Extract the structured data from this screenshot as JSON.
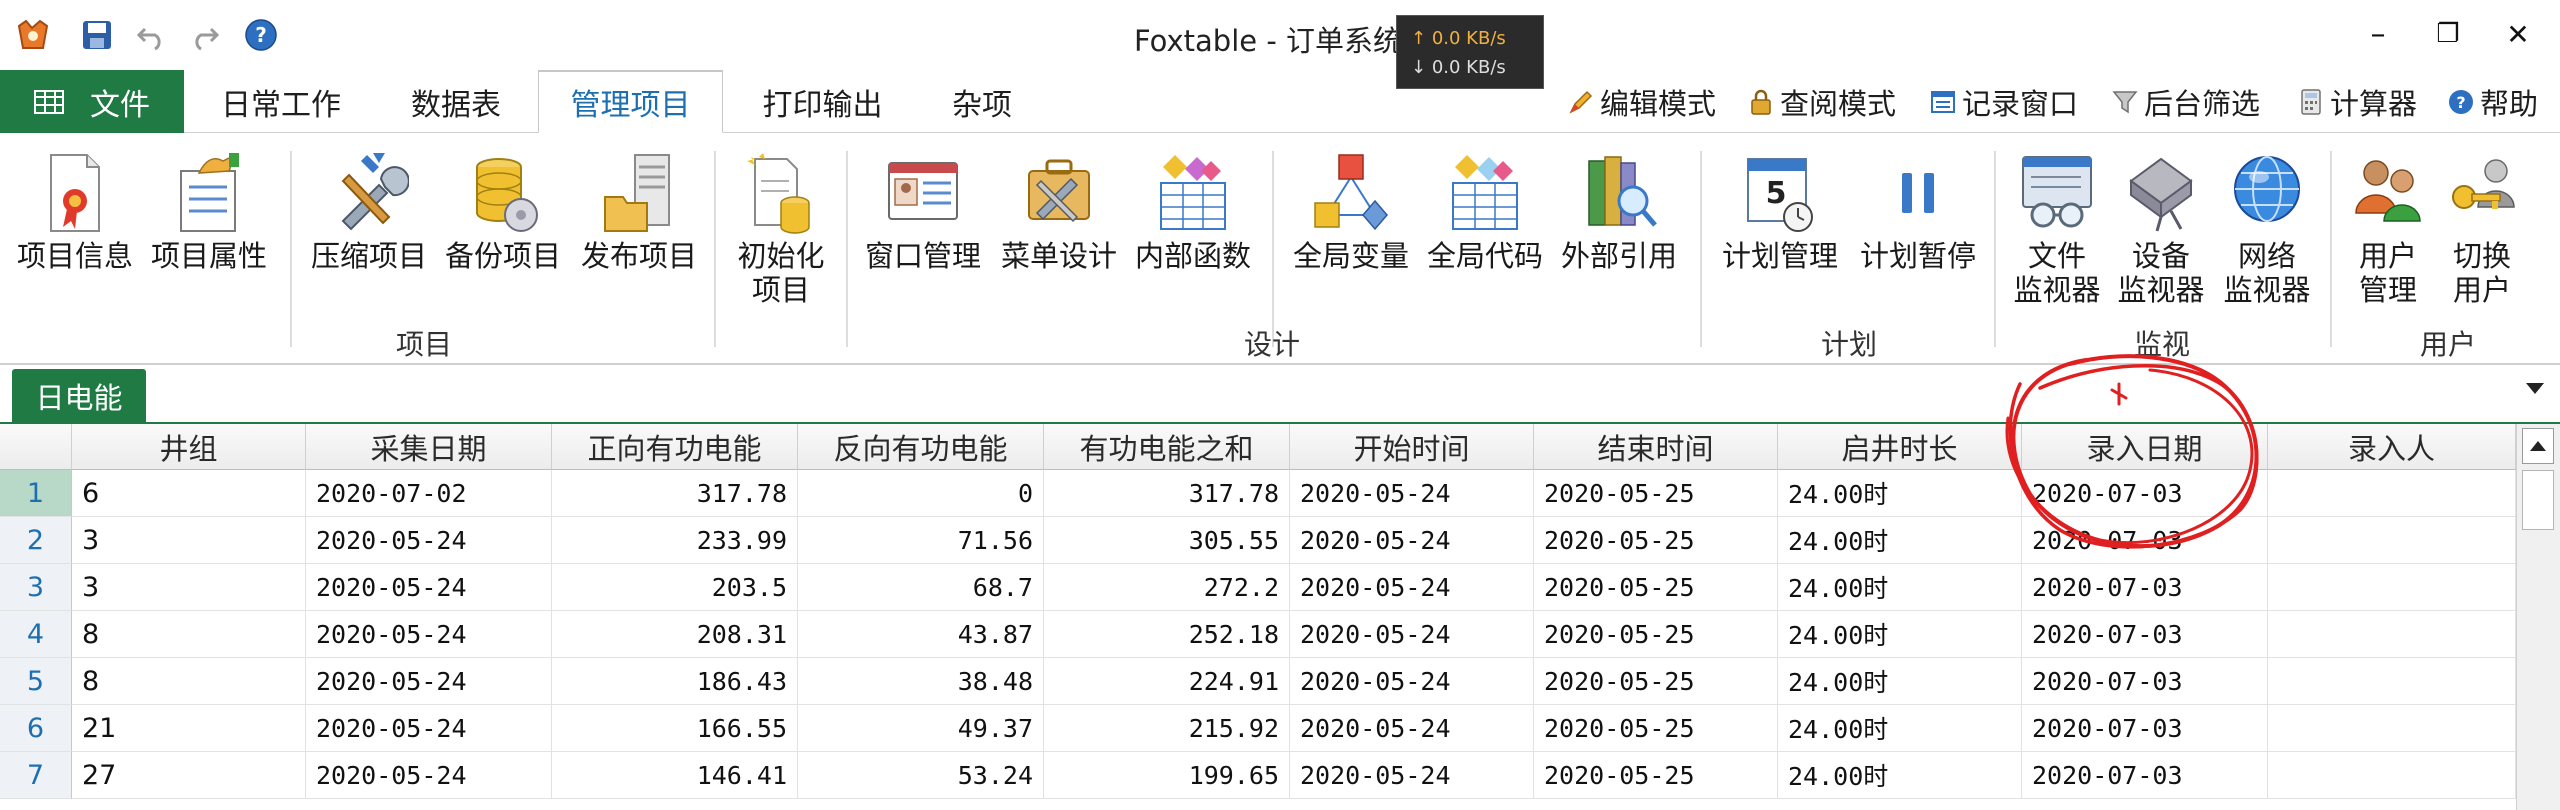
{
  "window": {
    "title": "Foxtable - 订单系统",
    "net_up": "0.0 KB/s",
    "net_down": "0.0 KB/s",
    "net_up_arrow": "↑",
    "net_down_arrow": "↓",
    "minimize": "–",
    "restore": "❐",
    "close": "✕"
  },
  "quick_access": {
    "icons": [
      "app-icon",
      "save-icon",
      "undo-icon",
      "redo-icon",
      "help-icon"
    ]
  },
  "tabs": {
    "file": "文件",
    "items": [
      "日常工作",
      "数据表",
      "管理项目",
      "打印输出",
      "杂项"
    ],
    "active": "管理项目"
  },
  "right_commands": [
    "编辑模式",
    "查阅模式",
    "记录窗口",
    "后台筛选",
    "计算器",
    "帮助"
  ],
  "ribbon": {
    "groups": [
      "项目",
      "设计",
      "计划",
      "监视",
      "用户"
    ],
    "buttons": {
      "project_info": [
        "项目信息"
      ],
      "project_props": [
        "项目属性"
      ],
      "compress": [
        "压缩项目"
      ],
      "backup": [
        "备份项目"
      ],
      "publish": [
        "发布项目"
      ],
      "init": [
        "初始化",
        "项目"
      ],
      "window_mgmt": [
        "窗口管理"
      ],
      "menu_design": [
        "菜单设计"
      ],
      "internal_func": [
        "内部函数"
      ],
      "global_var": [
        "全局变量"
      ],
      "global_code": [
        "全局代码"
      ],
      "external_ref": [
        "外部引用"
      ],
      "plan_mgmt": [
        "计划管理"
      ],
      "plan_pause": [
        "计划暂停"
      ],
      "file_monitor": [
        "文件",
        "监视器"
      ],
      "device_monitor": [
        "设备",
        "监视器"
      ],
      "net_monitor": [
        "网络",
        "监视器"
      ],
      "user_mgmt": [
        "用户",
        "管理"
      ],
      "switch_user": [
        "切换",
        "用户"
      ]
    }
  },
  "doc_tab": "日电能",
  "table": {
    "columns": [
      "井组",
      "采集日期",
      "正向有功电能",
      "反向有功电能",
      "有功电能之和",
      "开始时间",
      "结束时间",
      "启井时长",
      "录入日期",
      "录入人"
    ],
    "rows": [
      {
        "n": "1",
        "c": [
          "6",
          "2020-07-02",
          "317.78",
          "0",
          "317.78",
          "2020-05-24",
          "2020-05-25",
          "24.00时",
          "2020-07-03",
          ""
        ]
      },
      {
        "n": "2",
        "c": [
          "3",
          "2020-05-24",
          "233.99",
          "71.56",
          "305.55",
          "2020-05-24",
          "2020-05-25",
          "24.00时",
          "2020-07-03",
          ""
        ]
      },
      {
        "n": "3",
        "c": [
          "3",
          "2020-05-24",
          "203.5",
          "68.7",
          "272.2",
          "2020-05-24",
          "2020-05-25",
          "24.00时",
          "2020-07-03",
          ""
        ]
      },
      {
        "n": "4",
        "c": [
          "8",
          "2020-05-24",
          "208.31",
          "43.87",
          "252.18",
          "2020-05-24",
          "2020-05-25",
          "24.00时",
          "2020-07-03",
          ""
        ]
      },
      {
        "n": "5",
        "c": [
          "8",
          "2020-05-24",
          "186.43",
          "38.48",
          "224.91",
          "2020-05-24",
          "2020-05-25",
          "24.00时",
          "2020-07-03",
          ""
        ]
      },
      {
        "n": "6",
        "c": [
          "21",
          "2020-05-24",
          "166.55",
          "49.37",
          "215.92",
          "2020-05-24",
          "2020-05-25",
          "24.00时",
          "2020-07-03",
          ""
        ]
      },
      {
        "n": "7",
        "c": [
          "27",
          "2020-05-24",
          "146.41",
          "53.24",
          "199.65",
          "2020-05-24",
          "2020-05-25",
          "24.00时",
          "2020-07-03",
          ""
        ]
      }
    ]
  },
  "colors": {
    "accent_green": "#1f7a44",
    "active_tab_text": "#1e6fb0",
    "annotation_red": "#e02020"
  }
}
